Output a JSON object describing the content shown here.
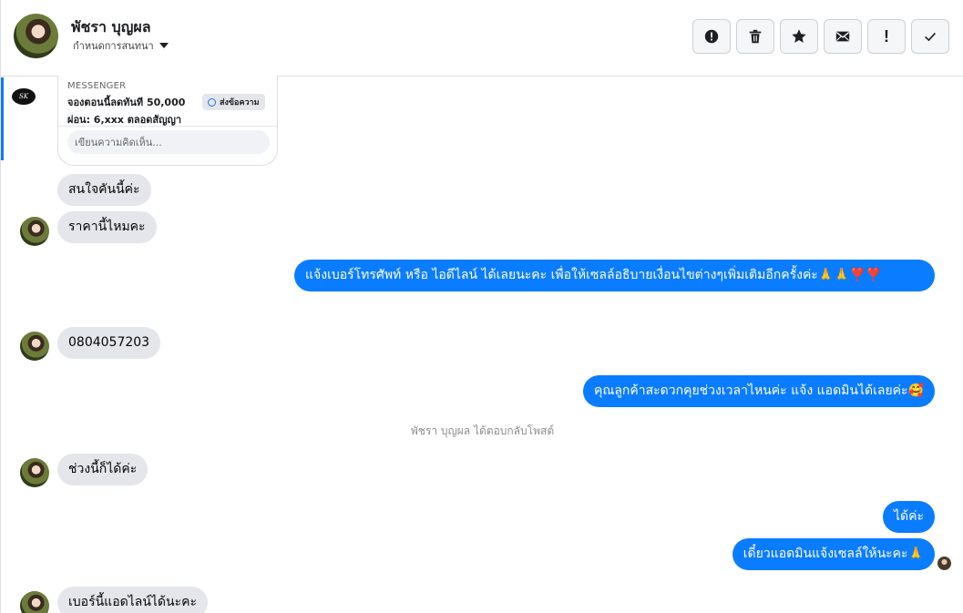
{
  "header": {
    "contact_name": "พัชรา บุญผล",
    "status_label": "กำหนดการสนทนา",
    "actions": [
      {
        "name": "report-spam-button",
        "icon": "alert-circle-icon"
      },
      {
        "name": "delete-button",
        "icon": "trash-icon"
      },
      {
        "name": "star-button",
        "icon": "star-icon"
      },
      {
        "name": "mark-unread-button",
        "icon": "envelope-icon"
      },
      {
        "name": "important-button",
        "icon": "exclamation-icon",
        "label": "!"
      },
      {
        "name": "mark-done-button",
        "icon": "check-icon"
      }
    ]
  },
  "ad_card": {
    "label": "MESSENGER",
    "line1": "จองตอนนี้ลดทันที 50,000",
    "line2": "ผ่อน: 6,xxx ตลอดสัญญา",
    "button_label": "ส่งข้อความ",
    "comment_placeholder": "เขียนความคิดเห็น...",
    "page_logo_text": "SK"
  },
  "messages": [
    {
      "dir": "in",
      "text": "สนใจคันนี้ค่ะ"
    },
    {
      "dir": "in",
      "text": "ราคานี้ไหมคะ"
    },
    {
      "dir": "out",
      "text": "แจ้งเบอร์โทรศัพท์ หรือ ไอดีไลน์  ได้เลยนะคะ  เพื่อให้เซลล์อธิบายเงื่อนไขต่างๆเพิ่มเติมอีกครั้งค่ะ🙏🙏❣️❣️"
    },
    {
      "dir": "in",
      "text": "0804057203"
    },
    {
      "dir": "out",
      "text": "คุณลูกค้าสะดวกคุยช่วงเวลาไหนค่ะ แจ้ง แอดมินได้เลยค่ะ🥰"
    },
    {
      "dir": "in",
      "text": "ช่วงนี้ก็ได้ค่ะ"
    },
    {
      "dir": "out",
      "text": "ได้ค่ะ"
    },
    {
      "dir": "out",
      "text": "เดี๋ยวแอดมินแจ้งเซลล์ให้นะคะ🙏"
    },
    {
      "dir": "in",
      "text": "เบอร์นี้แอดไลน์ได้นะคะ"
    }
  ],
  "system_message": "พัชรา บุญผล ได้ตอบกลับโพสต์",
  "colors": {
    "outgoing": "#0a7cff",
    "incoming": "#e4e6eb",
    "accent": "#1877f2"
  }
}
